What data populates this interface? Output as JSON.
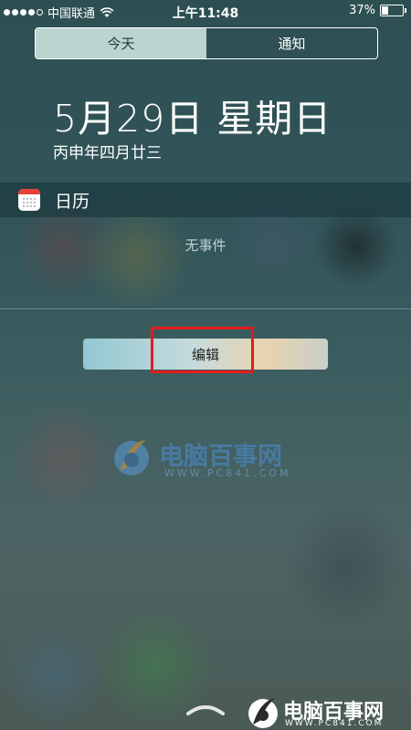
{
  "status_bar": {
    "signal_dots_filled": 4,
    "signal_dots_total": 5,
    "carrier": "中国联通",
    "time": "上午11:48",
    "battery_percent_label": "37%",
    "battery_level": 0.37
  },
  "segmented_control": {
    "tabs": [
      {
        "label": "今天",
        "active": true
      },
      {
        "label": "通知",
        "active": false
      }
    ]
  },
  "date": {
    "main": "5月29日 星期日",
    "lunar": "丙申年四月廿三"
  },
  "calendar_widget": {
    "title": "日历",
    "icon": "calendar-icon",
    "empty_text": "无事件"
  },
  "edit_button": {
    "label": "编辑",
    "highlight_color": "#e31c1c"
  },
  "watermark": {
    "name": "电脑百事网",
    "url": "WWW.PC841.COM"
  },
  "corner_watermark": {
    "name": "电脑百事网",
    "url": "WWW.PC841.COM"
  },
  "colors": {
    "segment_active_bg": "#d2ebe6",
    "edit_button_start": "#93c7d2",
    "edit_button_end": "#c9cfc8"
  }
}
